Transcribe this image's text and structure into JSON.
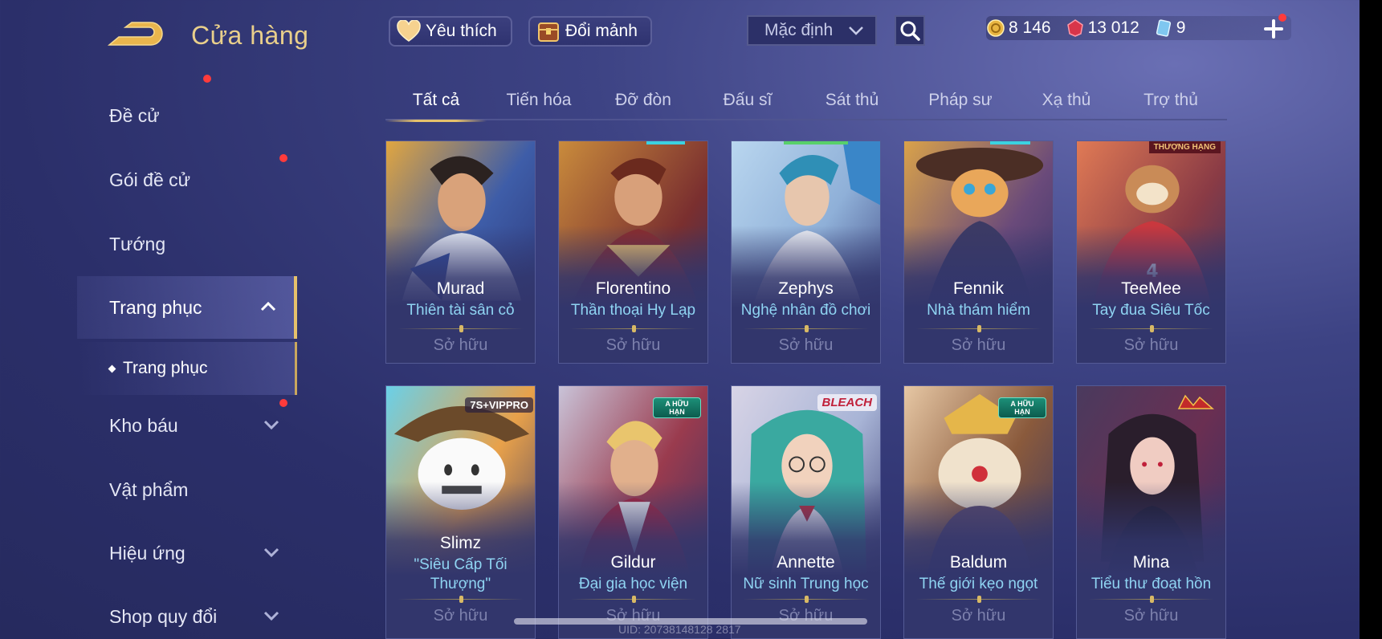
{
  "header": {
    "title": "Cửa hàng",
    "favorite_label": "Yêu thích",
    "exchange_label": "Đổi mảnh",
    "sort_label": "Mặc định"
  },
  "currency": {
    "gold": "8 146",
    "vouchers": "13 012",
    "tickets": "9"
  },
  "sidebar": {
    "items": [
      {
        "label": "Đề cử"
      },
      {
        "label": "Gói đề cử"
      },
      {
        "label": "Tướng"
      },
      {
        "label": "Trang phục"
      },
      {
        "label": "Kho báu"
      },
      {
        "label": "Vật phẩm"
      },
      {
        "label": "Hiệu ứng"
      },
      {
        "label": "Shop quy đổi"
      }
    ],
    "sub_item": "Trang phục"
  },
  "tabs": [
    "Tất cả",
    "Tiến hóa",
    "Đỡ đòn",
    "Đấu sĩ",
    "Sát thủ",
    "Pháp sư",
    "Xạ thủ",
    "Trợ thủ"
  ],
  "cards": [
    {
      "hero": "Murad",
      "skin": "Thiên tài sân cỏ",
      "status": "Sở hữu"
    },
    {
      "hero": "Florentino",
      "skin": "Thần thoại Hy Lạp",
      "status": "Sở hữu"
    },
    {
      "hero": "Zephys",
      "skin": "Nghệ nhân đồ chơi",
      "status": "Sở hữu"
    },
    {
      "hero": "Fennik",
      "skin": "Nhà thám hiểm",
      "status": "Sở hữu"
    },
    {
      "hero": "TeeMee",
      "skin": "Tay đua Siêu Tốc",
      "status": "Sở hữu",
      "tag": "THƯỢNG HẠNG"
    },
    {
      "hero": "Slimz",
      "skin": "\"Siêu Cấp Tối Thượng\"",
      "status": "Sở hữu",
      "tag": "7S+VIPPRO"
    },
    {
      "hero": "Gildur",
      "skin": "Đại gia học viện",
      "status": "Sở hữu",
      "tag": "A HỮU HẠN"
    },
    {
      "hero": "Annette",
      "skin": "Nữ sinh Trung học",
      "status": "Sở hữu",
      "tag": "BLEACH"
    },
    {
      "hero": "Baldum",
      "skin": "Thế giới kẹo ngọt",
      "status": "Sở hữu",
      "tag": "A HỮU HẠN"
    },
    {
      "hero": "Mina",
      "skin": "Tiểu thư đoạt hồn",
      "status": "Sở hữu"
    }
  ],
  "footer": {
    "uid": "UID: 20738148128 2817"
  },
  "colors": {
    "accent_gold": "#e6c16b",
    "skin_blue": "#8fd4f2",
    "notification_red": "#ff3b3b"
  }
}
